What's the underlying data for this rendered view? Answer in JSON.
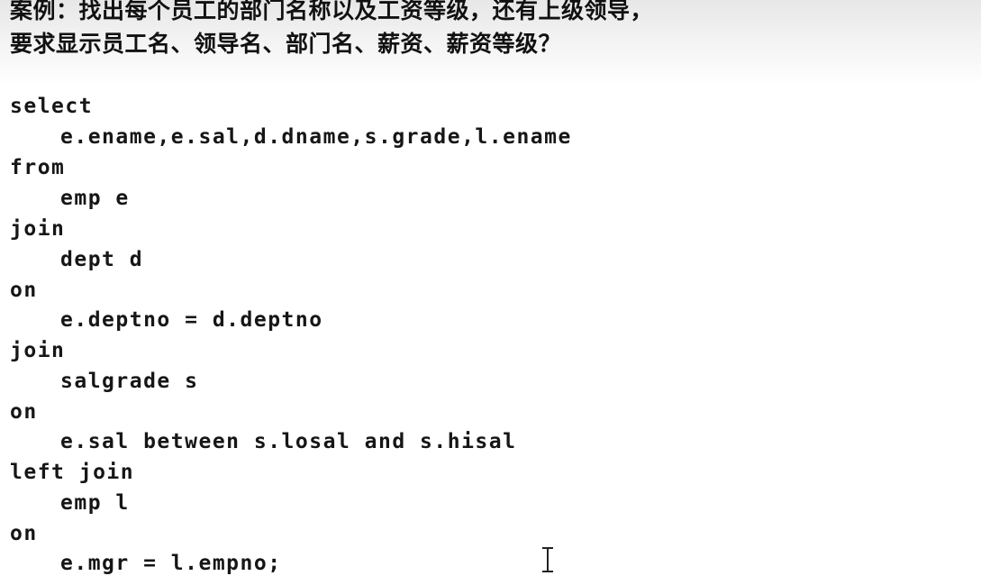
{
  "title": {
    "line1": "案例：找出每个员工的部门名称以及工资等级，还有上级领导，",
    "line2": "要求显示员工名、领导名、部门名、薪资、薪资等级？"
  },
  "code": {
    "l01": "select",
    "l02": "e.ename,e.sal,d.dname,s.grade,l.ename",
    "l03": "from",
    "l04": "emp e",
    "l05": "join",
    "l06": "dept d",
    "l07": "on",
    "l08": "e.deptno = d.deptno",
    "l09": "join",
    "l10": "salgrade s",
    "l11": "on",
    "l12": "e.sal between s.losal and s.hisal",
    "l13": "left join",
    "l14": "emp l",
    "l15": "on",
    "l16": "e.mgr = l.empno;"
  },
  "colors": {
    "text": "#161616",
    "header_gradient_top": "#e7e7e7",
    "background": "#ffffff"
  },
  "icons": {
    "cursor": "text-ibeam-cursor-icon"
  }
}
